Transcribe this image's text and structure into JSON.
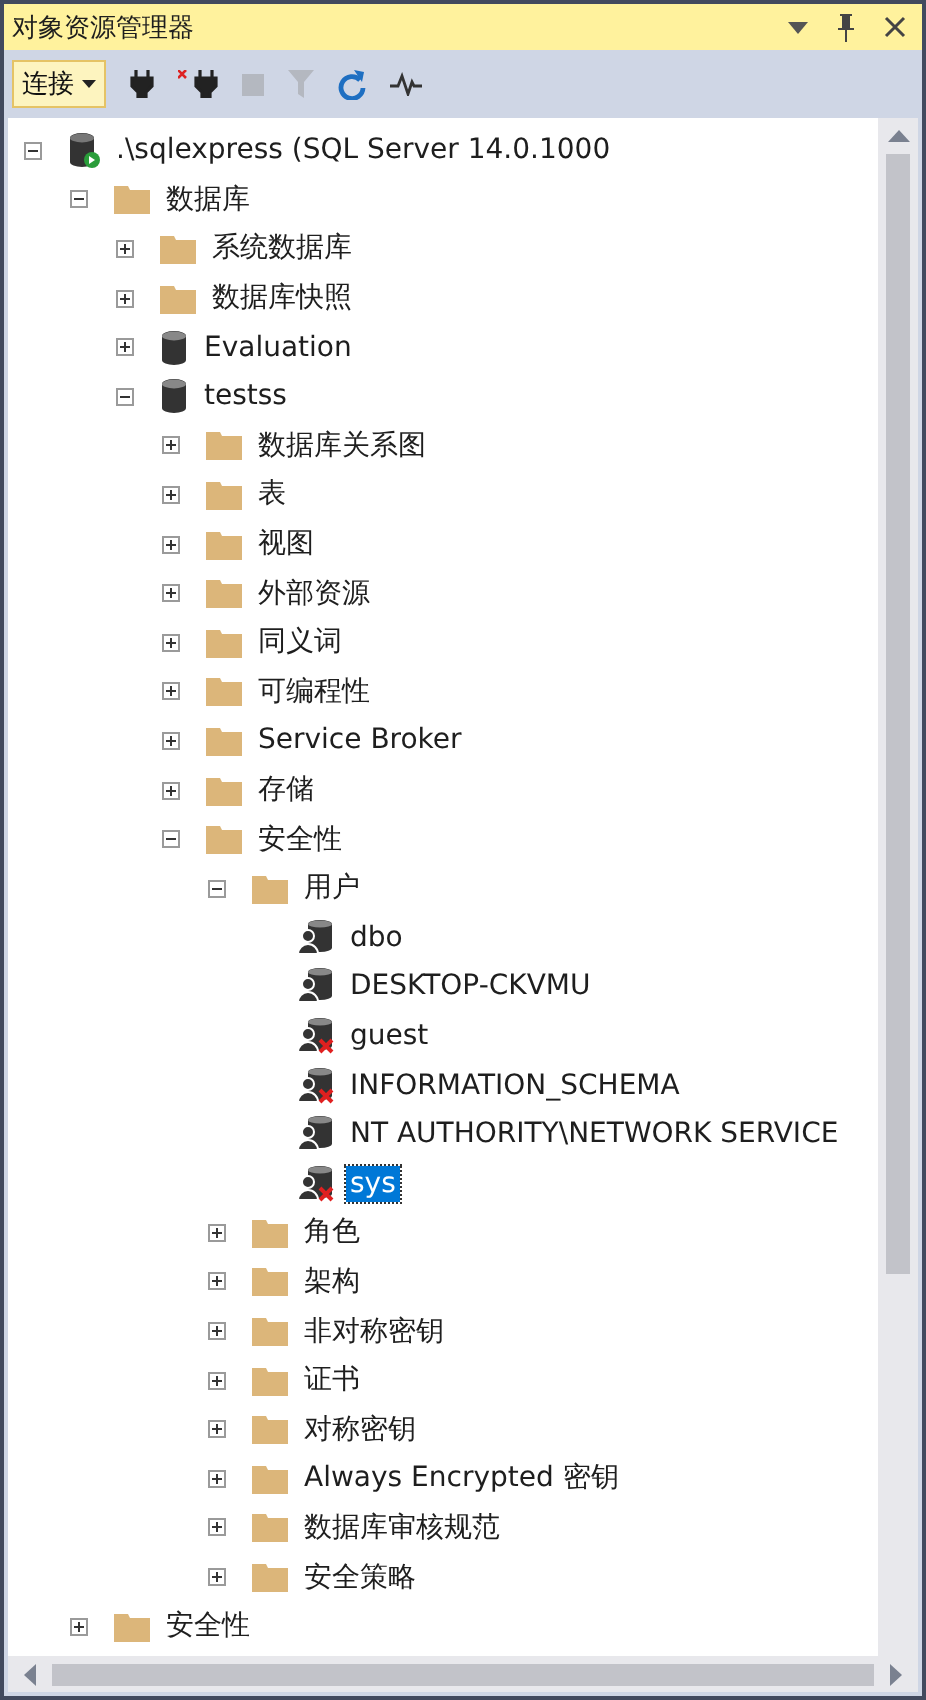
{
  "window": {
    "title": "对象资源管理器"
  },
  "toolbar": {
    "connect_button": "连接"
  },
  "tree": [
    {
      "kind": "server",
      "label": ".\\sqlexpress (SQL Server 14.0.1000",
      "expanded": true,
      "selected": false,
      "children": [
        {
          "kind": "folder",
          "label": "数据库",
          "expanded": true,
          "selected": false,
          "children": [
            {
              "kind": "folder",
              "label": "系统数据库",
              "expanded": false,
              "selected": false
            },
            {
              "kind": "folder",
              "label": "数据库快照",
              "expanded": false,
              "selected": false
            },
            {
              "kind": "database",
              "label": "Evaluation",
              "expanded": false,
              "selected": false
            },
            {
              "kind": "database",
              "label": "testss",
              "expanded": true,
              "selected": false,
              "children": [
                {
                  "kind": "folder",
                  "label": "数据库关系图",
                  "expanded": false,
                  "selected": false
                },
                {
                  "kind": "folder",
                  "label": "表",
                  "expanded": false,
                  "selected": false
                },
                {
                  "kind": "folder",
                  "label": "视图",
                  "expanded": false,
                  "selected": false
                },
                {
                  "kind": "folder",
                  "label": "外部资源",
                  "expanded": false,
                  "selected": false
                },
                {
                  "kind": "folder",
                  "label": "同义词",
                  "expanded": false,
                  "selected": false
                },
                {
                  "kind": "folder",
                  "label": "可编程性",
                  "expanded": false,
                  "selected": false
                },
                {
                  "kind": "folder",
                  "label": "Service Broker",
                  "expanded": false,
                  "selected": false
                },
                {
                  "kind": "folder",
                  "label": "存储",
                  "expanded": false,
                  "selected": false
                },
                {
                  "kind": "folder",
                  "label": "安全性",
                  "expanded": true,
                  "selected": false,
                  "children": [
                    {
                      "kind": "folder",
                      "label": "用户",
                      "expanded": true,
                      "selected": false,
                      "children": [
                        {
                          "kind": "user",
                          "label": "dbo",
                          "selected": false
                        },
                        {
                          "kind": "user",
                          "label": "DESKTOP-CKVMU",
                          "selected": false
                        },
                        {
                          "kind": "user-disabled",
                          "label": "guest",
                          "selected": false
                        },
                        {
                          "kind": "user-disabled",
                          "label": "INFORMATION_SCHEMA",
                          "selected": false
                        },
                        {
                          "kind": "user",
                          "label": "NT AUTHORITY\\NETWORK SERVICE",
                          "selected": false
                        },
                        {
                          "kind": "user-disabled",
                          "label": "sys",
                          "selected": true
                        }
                      ]
                    },
                    {
                      "kind": "folder",
                      "label": "角色",
                      "expanded": false,
                      "selected": false
                    },
                    {
                      "kind": "folder",
                      "label": "架构",
                      "expanded": false,
                      "selected": false
                    },
                    {
                      "kind": "folder",
                      "label": "非对称密钥",
                      "expanded": false,
                      "selected": false
                    },
                    {
                      "kind": "folder",
                      "label": "证书",
                      "expanded": false,
                      "selected": false
                    },
                    {
                      "kind": "folder",
                      "label": "对称密钥",
                      "expanded": false,
                      "selected": false
                    },
                    {
                      "kind": "folder",
                      "label": "Always Encrypted 密钥",
                      "expanded": false,
                      "selected": false
                    },
                    {
                      "kind": "folder",
                      "label": "数据库审核规范",
                      "expanded": false,
                      "selected": false
                    },
                    {
                      "kind": "folder",
                      "label": "安全策略",
                      "expanded": false,
                      "selected": false
                    }
                  ]
                }
              ]
            }
          ]
        },
        {
          "kind": "folder",
          "label": "安全性",
          "expanded": false,
          "selected": false
        }
      ]
    }
  ]
}
